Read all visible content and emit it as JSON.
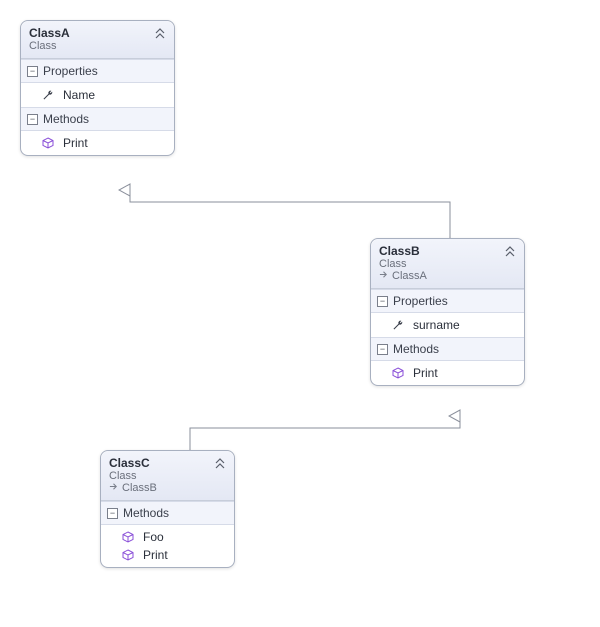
{
  "labels": {
    "stereotype": "Class",
    "properties": "Properties",
    "methods": "Methods"
  },
  "classA": {
    "name": "ClassA",
    "properties": [
      {
        "name": "Name"
      }
    ],
    "methods": [
      {
        "name": "Print"
      }
    ]
  },
  "classB": {
    "name": "ClassB",
    "base": "ClassA",
    "properties": [
      {
        "name": "surname"
      }
    ],
    "methods": [
      {
        "name": "Print"
      }
    ]
  },
  "classC": {
    "name": "ClassC",
    "base": "ClassB",
    "methods": [
      {
        "name": "Foo"
      },
      {
        "name": "Print"
      }
    ]
  },
  "icons": {
    "collapse_glyph": "−"
  }
}
